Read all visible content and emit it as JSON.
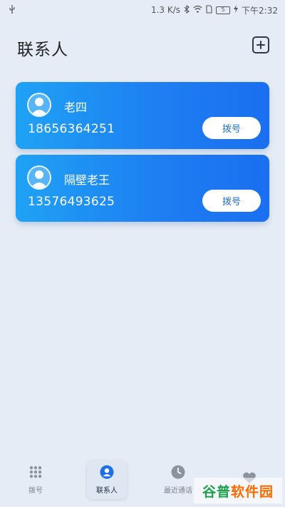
{
  "status_bar": {
    "usb_icon": "usb-icon",
    "network_speed": "1.3 K/s",
    "battery_level": "5",
    "time": "下午2:32"
  },
  "header": {
    "title": "联系人",
    "add_icon": "plus-square-icon"
  },
  "contacts": [
    {
      "name": "老四",
      "phone": "18656364251",
      "dial_label": "拨号"
    },
    {
      "name": "隔壁老王",
      "phone": "13576493625",
      "dial_label": "拨号"
    }
  ],
  "bottom_nav": {
    "items": [
      {
        "label": "拨号",
        "icon": "dialpad-icon",
        "active": false
      },
      {
        "label": "联系人",
        "icon": "person-icon",
        "active": true
      },
      {
        "label": "最近通话",
        "icon": "clock-icon",
        "active": false
      },
      {
        "label": "",
        "icon": "heart-icon",
        "active": false
      }
    ]
  },
  "watermark": {
    "first": "谷普",
    "rest": "软件园"
  },
  "colors": {
    "background": "#e6ecf6",
    "card_gradient_start": "#1fa2f5",
    "card_gradient_end": "#1a6ff0",
    "dial_text": "#1e6fd0",
    "watermark": "#ff6a00"
  }
}
